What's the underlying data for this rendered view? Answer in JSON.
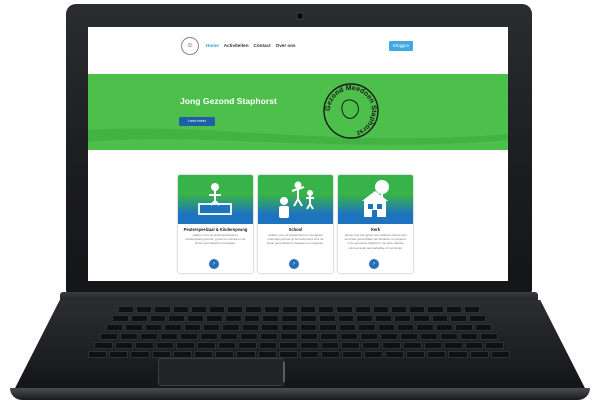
{
  "nav": {
    "logo": "☺",
    "links": [
      "Home",
      "Activiteiten",
      "Contact",
      "Over ons"
    ],
    "login": "Inloggen"
  },
  "hero": {
    "title": "Jong Gezond Staphorst",
    "button": "Lees meer",
    "badge_text": "Gezond Meedoen Staphorst"
  },
  "cards": [
    {
      "title": "Peuterspeelzaal & Kinderopvang",
      "text": "welkom voor de peuterspeelzaal en kinderopvang gezond, gymen en muziek en de kinder gezondheid en bewegen.",
      "icon": "sandbox-icon"
    },
    {
      "title": "School",
      "text": "welkom voor de basisschool en voortgezet onderwijs gezond op het leerproces voor de beste gezondheid en bewegen en omgeven.",
      "icon": "children-play-icon"
    },
    {
      "title": "Kerk",
      "text": "Samen met het geloof voor iedereen samen aan de kinder gezondheid met Kinderen en jongeren in de gemeente Staphorst. Op deze website ontmoet ieder aan kerkelijke of met kinder.",
      "icon": "house-tree-icon"
    }
  ],
  "colors": {
    "hero_green": "#4cc04a",
    "accent_blue": "#3fa9e0",
    "card_blue": "#1e73be",
    "button_navy": "#1f5fa8"
  }
}
